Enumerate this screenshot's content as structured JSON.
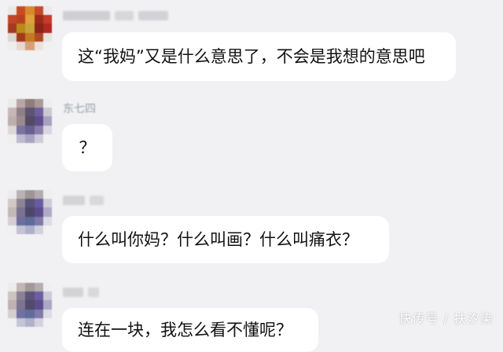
{
  "messages": [
    {
      "sender_name": "",
      "text": "这“我妈”又是什么意思了，不会是我想的意思吧"
    },
    {
      "sender_name": "东七四",
      "text": "？"
    },
    {
      "sender_name": "",
      "text": "什么叫你妈？什么叫画？什么叫痛衣？"
    },
    {
      "sender_name": "",
      "text": "连在一块，我怎么看不懂呢？"
    }
  ],
  "watermark": "快传号 / 扶汐染",
  "colors": {
    "background": "#f1f1f3",
    "bubble": "#ffffff",
    "text": "#111111"
  }
}
